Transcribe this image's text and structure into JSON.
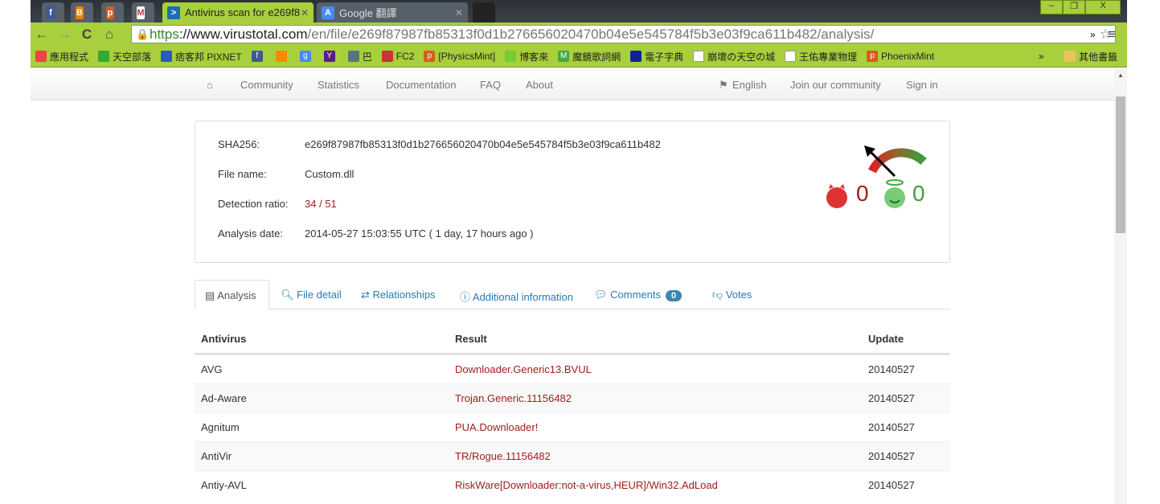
{
  "browser": {
    "tabs": [
      {
        "label": "Antivirus scan for e269f8",
        "active": true
      },
      {
        "label": "Google 翻譯",
        "active": false
      }
    ],
    "url_scheme": "https",
    "url_host": "://www.virustotal.com",
    "url_path": "/en/file/e269f87987fb85313f0d1b276656020470b04e5e545784f5b3e03f9ca611b482/analysis/",
    "bookmarks": [
      "應用程式",
      "天空部落",
      "痞客邦 PIXNET",
      "巴",
      "FC2",
      "[PhysicsMint]",
      "博客來",
      "魔鏡歌詞網",
      "電子字典",
      "崩壞の天空の城",
      "王佑專業物理",
      "PhoenixMint"
    ],
    "other_bookmarks": "其他書籤"
  },
  "nav": {
    "items": [
      "Community",
      "Statistics",
      "Documentation",
      "FAQ",
      "About"
    ],
    "language": "English",
    "join": "Join our community",
    "signin": "Sign in"
  },
  "file": {
    "sha_label": "SHA256:",
    "sha": "e269f87987fb85313f0d1b276656020470b04e5e545784f5b3e03f9ca611b482",
    "name_label": "File name:",
    "name": "Custom.dll",
    "ratio_label": "Detection ratio:",
    "ratio": "34 / 51",
    "date_label": "Analysis date:",
    "date": "2014-05-27 15:03:55 UTC ( 1 day, 17 hours ago )",
    "votes_malicious": "0",
    "votes_harmless": "0",
    "colors": {
      "malicious": "#a01d1d",
      "harmless": "#3aa03a"
    }
  },
  "tabs": {
    "analysis": "Analysis",
    "file_detail": "File detail",
    "relationships": "Relationships",
    "additional": "Additional information",
    "comments": "Comments",
    "comments_count": "0",
    "votes": "Votes"
  },
  "table": {
    "headers": [
      "Antivirus",
      "Result",
      "Update"
    ],
    "rows": [
      [
        "AVG",
        "Downloader.Generic13.BVUL",
        "20140527"
      ],
      [
        "Ad-Aware",
        "Trojan.Generic.11156482",
        "20140527"
      ],
      [
        "Agnitum",
        "PUA.Downloader!",
        "20140527"
      ],
      [
        "AntiVir",
        "TR/Rogue.11156482",
        "20140527"
      ],
      [
        "Antiy-AVL",
        "RiskWare[Downloader:not-a-virus,HEUR]/Win32.AdLoad",
        "20140527"
      ]
    ]
  }
}
